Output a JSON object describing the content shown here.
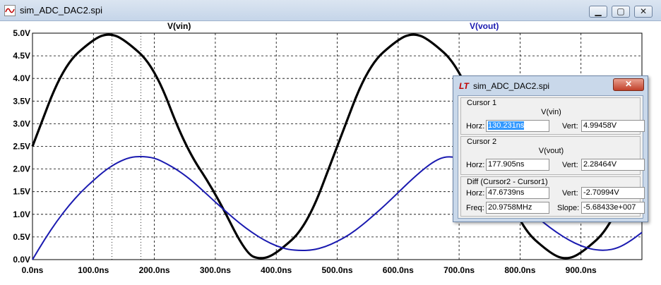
{
  "window": {
    "title": "sim_ADC_DAC2.spi",
    "minimize": "▁",
    "maximize": "▢",
    "close": "✕"
  },
  "traces": {
    "vin_label": "V(vin)",
    "vout_label": "V(vout)"
  },
  "chart_data": {
    "type": "line",
    "title": "",
    "xlabel": "",
    "ylabel": "",
    "xlim": [
      0,
      1000
    ],
    "ylim": [
      0,
      5
    ],
    "grid": true,
    "x_ticks": [
      "0.0ns",
      "100.0ns",
      "200.0ns",
      "300.0ns",
      "400.0ns",
      "500.0ns",
      "600.0ns",
      "700.0ns",
      "800.0ns",
      "900.0ns"
    ],
    "y_ticks": [
      "0.0V",
      "0.5V",
      "1.0V",
      "1.5V",
      "2.0V",
      "2.5V",
      "3.0V",
      "3.5V",
      "4.0V",
      "4.5V",
      "5.0V"
    ],
    "series": [
      {
        "name": "V(vin)",
        "color": "#000000",
        "x": [
          0,
          50,
          100,
          125,
          150,
          200,
          250,
          300,
          350,
          375,
          400,
          450,
          500,
          550,
          600,
          625,
          650,
          700,
          750,
          800,
          850,
          875,
          900,
          950,
          1000
        ],
        "y": [
          2.5,
          4.27,
          4.87,
          5.0,
          4.87,
          4.27,
          2.5,
          1.48,
          0.13,
          0.0,
          0.13,
          0.73,
          2.5,
          4.27,
          4.87,
          5.0,
          4.87,
          4.27,
          2.5,
          0.73,
          0.13,
          0.0,
          0.13,
          0.73,
          2.5
        ]
      },
      {
        "name": "V(vout)",
        "color": "#1a1ab0",
        "x": [
          0,
          20,
          40,
          60,
          80,
          100,
          120,
          140,
          160,
          178,
          200,
          220,
          240,
          260,
          280,
          300,
          320,
          340,
          360,
          380,
          400,
          420,
          440,
          460,
          480,
          500,
          520,
          540,
          560,
          580,
          600,
          620,
          640,
          660,
          678,
          700,
          720,
          740,
          760,
          780,
          800,
          820,
          840,
          860,
          880,
          900,
          920,
          940,
          960,
          980,
          1000
        ],
        "y": [
          0.0,
          0.45,
          0.85,
          1.2,
          1.5,
          1.75,
          1.98,
          2.15,
          2.26,
          2.28,
          2.25,
          2.12,
          1.96,
          1.76,
          1.52,
          1.27,
          1.03,
          0.8,
          0.6,
          0.43,
          0.3,
          0.22,
          0.2,
          0.21,
          0.28,
          0.4,
          0.55,
          0.75,
          0.98,
          1.22,
          1.48,
          1.74,
          1.98,
          2.18,
          2.28,
          2.25,
          2.12,
          1.96,
          1.76,
          1.52,
          1.27,
          1.03,
          0.8,
          0.6,
          0.43,
          0.3,
          0.22,
          0.2,
          0.25,
          0.4,
          0.6
        ]
      }
    ]
  },
  "cursor_dialog": {
    "title": "sim_ADC_DAC2.spi",
    "close": "✕",
    "cursor1": {
      "title": "Cursor 1",
      "signal": "V(vin)",
      "horz_label": "Horz:",
      "horz": "130.231ns",
      "vert_label": "Vert:",
      "vert": "4.99458V"
    },
    "cursor2": {
      "title": "Cursor 2",
      "signal": "V(vout)",
      "horz_label": "Horz:",
      "horz": "177.905ns",
      "vert_label": "Vert:",
      "vert": "2.28464V"
    },
    "diff": {
      "title": "Diff (Cursor2 - Cursor1)",
      "horz_label": "Horz:",
      "horz": "47.6739ns",
      "vert_label": "Vert:",
      "vert": "-2.70994V",
      "freq_label": "Freq:",
      "freq": "20.9758MHz",
      "slope_label": "Slope:",
      "slope": "-5.68433e+007"
    }
  }
}
